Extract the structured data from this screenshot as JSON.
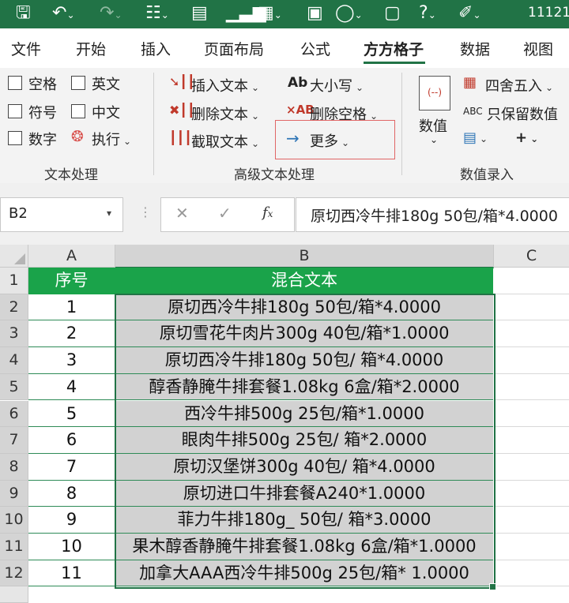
{
  "titlebar": {
    "right_text": "11121"
  },
  "tabs": [
    {
      "label": "文件"
    },
    {
      "label": "开始"
    },
    {
      "label": "插入"
    },
    {
      "label": "页面布局"
    },
    {
      "label": "公式"
    },
    {
      "label": "方方格子"
    },
    {
      "label": "数据"
    },
    {
      "label": "视图"
    }
  ],
  "active_tab": "方方格子",
  "ribbon": {
    "text_group": {
      "checkboxes": [
        {
          "label": "空格"
        },
        {
          "label": "英文"
        },
        {
          "label": "符号"
        },
        {
          "label": "中文"
        },
        {
          "label": "数字"
        }
      ],
      "execute_label": "执行",
      "group_label": "文本处理"
    },
    "advanced_group": {
      "insert_text": "插入文本",
      "delete_text": "删除文本",
      "cut_text": "截取文本",
      "case": "大小写",
      "case_icon": "Ab",
      "delete_space": "删除空格",
      "more": "更多",
      "group_label": "高级文本处理"
    },
    "number_group": {
      "value_label": "数值",
      "round_label": "四舍五入",
      "keep_values_label": "只保留数值",
      "keep_values_icon": "ABC",
      "group_label": "数值录入"
    }
  },
  "formula_bar": {
    "name_box": "B2",
    "formula": "原切西冷牛排180g 50包/箱*4.0000"
  },
  "grid": {
    "columns": [
      "A",
      "B",
      "C"
    ],
    "header_row": {
      "a": "序号",
      "b": "混合文本"
    },
    "rows": [
      {
        "row": "2",
        "a": "1",
        "b": "原切西冷牛排180g 50包/箱*4.0000"
      },
      {
        "row": "3",
        "a": "2",
        "b": "原切雪花牛肉片300g 40包/箱*1.0000"
      },
      {
        "row": "4",
        "a": "3",
        "b": "原切西冷牛排180g 50包/ 箱*4.0000"
      },
      {
        "row": "5",
        "a": "4",
        "b": "醇香静腌牛排套餐1.08kg 6盒/箱*2.0000"
      },
      {
        "row": "6",
        "a": "5",
        "b": "西冷牛排500g 25包/箱*1.0000"
      },
      {
        "row": "7",
        "a": "6",
        "b": "眼肉牛排500g 25包/ 箱*2.0000"
      },
      {
        "row": "8",
        "a": "7",
        "b": "原切汉堡饼300g 40包/ 箱*4.0000"
      },
      {
        "row": "9",
        "a": "8",
        "b": "原切进口牛排套餐A240*1.0000"
      },
      {
        "row": "10",
        "a": "9",
        "b": "菲力牛排180g_ 50包/ 箱*3.0000"
      },
      {
        "row": "11",
        "a": "10",
        "b": "果木醇香静腌牛排套餐1.08kg 6盒/箱*1.0000"
      },
      {
        "row": "12",
        "a": "11",
        "b": "加拿大AAA西冷牛排500g 25包/箱* 1.0000"
      }
    ],
    "first_row_label": "1"
  },
  "colors": {
    "excel_green": "#217346",
    "header_fill": "#1aa34a",
    "selection_fill": "#d2d2d2",
    "more_highlight": "#e06666"
  }
}
